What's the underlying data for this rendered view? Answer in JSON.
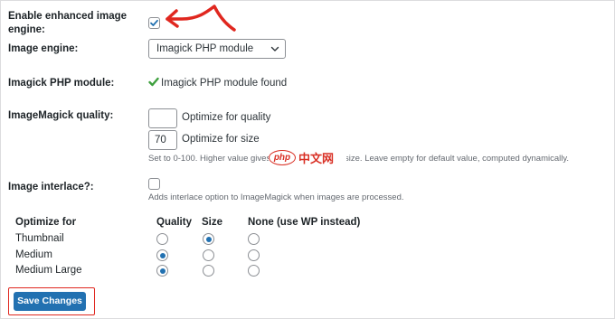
{
  "settings": {
    "enable_label_line1": "Enable enhanced image",
    "enable_label_line2": "engine:",
    "engine_label": "Image engine:",
    "engine_value": "Imagick PHP module",
    "module_label": "Imagick PHP module:",
    "module_status": "Imagick PHP module found",
    "quality_label": "ImageMagick quality:",
    "quality_value": "",
    "quality_option_label": "Optimize for quality",
    "size_value": "70",
    "size_option_label": "Optimize for size",
    "quality_desc": "Set to 0-100. Higher value gives b… …ut larger file size. Leave empty for default value, computed dynamically.",
    "interlace_label": "Image interlace?:",
    "interlace_desc": "Adds interlace option to ImageMagick when images are processed."
  },
  "watermark": {
    "badge": "php",
    "text": "中文网"
  },
  "optimize_table": {
    "headers": [
      "Optimize for",
      "Quality",
      "Size",
      "None (use WP instead)"
    ],
    "rows": [
      {
        "label": "Thumbnail",
        "selected": "size"
      },
      {
        "label": "Medium",
        "selected": "quality"
      },
      {
        "label": "Medium Large",
        "selected": "quality"
      }
    ]
  },
  "save_button": "Save Changes",
  "colors": {
    "accent": "#2271b1",
    "annotation": "#e0271f",
    "success": "#3ea03e",
    "text": "#1d2327",
    "muted": "#646970"
  }
}
